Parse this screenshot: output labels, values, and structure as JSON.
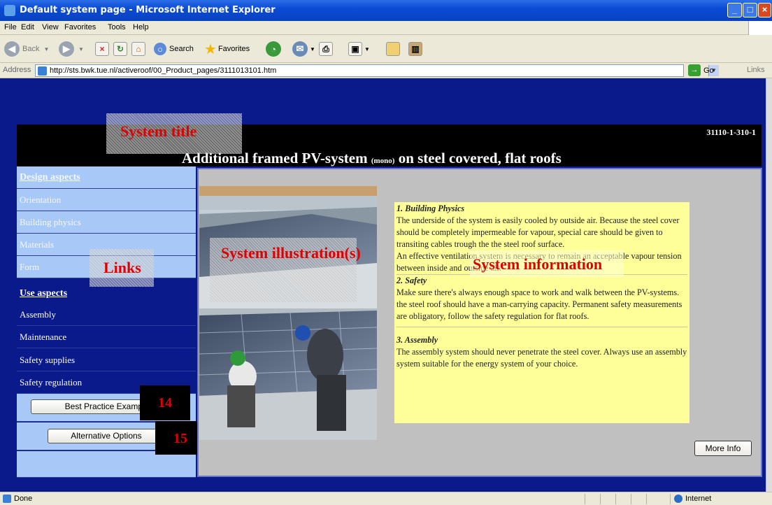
{
  "window": {
    "title": "Default system page - Microsoft Internet Explorer"
  },
  "menu": [
    "File",
    "Edit",
    "View",
    "Favorites",
    "Tools",
    "Help"
  ],
  "toolbar": {
    "back": "Back",
    "search": "Search",
    "favorites": "Favorites"
  },
  "address": {
    "label": "Address",
    "url": "http://sts.bwk.tue.nl/activeroof/00_Product_pages/3111013101.htm",
    "go": "Go",
    "links": "Links"
  },
  "header": {
    "code": "31110-1-310-1",
    "title_pre": "Additional framed PV-system ",
    "title_small": "(mono)",
    "title_post": " on steel covered, flat roofs"
  },
  "sidebar": {
    "items": [
      {
        "label": "Design aspects"
      },
      {
        "label": "Orientation"
      },
      {
        "label": "Building physics"
      },
      {
        "label": "Materials"
      },
      {
        "label": "Form"
      },
      {
        "label": "Use aspects"
      },
      {
        "label": "Assembly"
      },
      {
        "label": "Maintenance"
      },
      {
        "label": "Safety supplies"
      },
      {
        "label": "Safety regulation"
      }
    ],
    "best_practice": "Best Practice Examples",
    "alternative": "Alternative Options"
  },
  "info": {
    "s1_title": "1. Building Physics",
    "s1_p1": "The underside of the system is easily cooled by outside air. Because the steel cover should be completely impermeable for vapour, special care should be given to transiting cables trough the the steel roof surface.",
    "s1_p2": "An effective ventilation system is necessary to remain an acceptable vapour tension between inside and outside air.",
    "s2_title": "2. Safety",
    "s2_p1": "Make sure there's always enough space to work and walk between the PV-systems. the steel roof should have a man-carrying capacity. Permanent safety measurements are obligatory, follow the safety regulation for flat roofs.",
    "s3_title": "3. Assembly",
    "s3_p1": "The assembly system should never penetrate the steel cover. Always use an assembly system suitable for the energy system of your choice."
  },
  "more_info": "More Info",
  "annotations": {
    "system_title": "System title",
    "links": "Links",
    "illustration": "System illustration(s)",
    "information": "System information",
    "n14": "14",
    "n15": "15"
  },
  "status": {
    "text": "Done",
    "zone": "Internet"
  }
}
